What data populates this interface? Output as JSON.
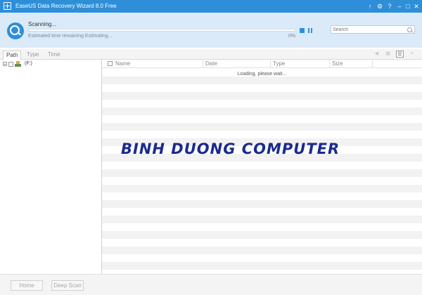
{
  "window": {
    "title": "EaseUS Data Recovery Wizard 8.0 Free",
    "controls": [
      "update-icon",
      "settings-icon",
      "help-icon",
      "minimize-icon",
      "maximize-icon",
      "close-icon"
    ],
    "colors": {
      "titlebar": "#2e8fd8",
      "header_bg": "#daeaf8"
    }
  },
  "scan": {
    "title": "Scanning...",
    "eta": "Estimated time remaining Estimating...",
    "percent_label": "0%",
    "progress": 0
  },
  "search": {
    "placeholder": "Search"
  },
  "tabs": [
    {
      "label": "Path",
      "active": true
    },
    {
      "label": "Type",
      "active": false
    },
    {
      "label": "Time",
      "active": false
    }
  ],
  "view_buttons": [
    "back-icon",
    "grid-view-icon",
    "list-view-icon",
    "detail-view-icon"
  ],
  "tree": {
    "root": {
      "label": "(F:)",
      "checked": false,
      "expanded": true
    }
  },
  "list": {
    "columns": [
      "Name",
      "Date",
      "Type",
      "Size"
    ],
    "status": "Loading, please wait..."
  },
  "watermark": "BINH DUONG COMPUTER",
  "buttons": {
    "home": "Home",
    "deep_scan": "Deep Scan"
  }
}
